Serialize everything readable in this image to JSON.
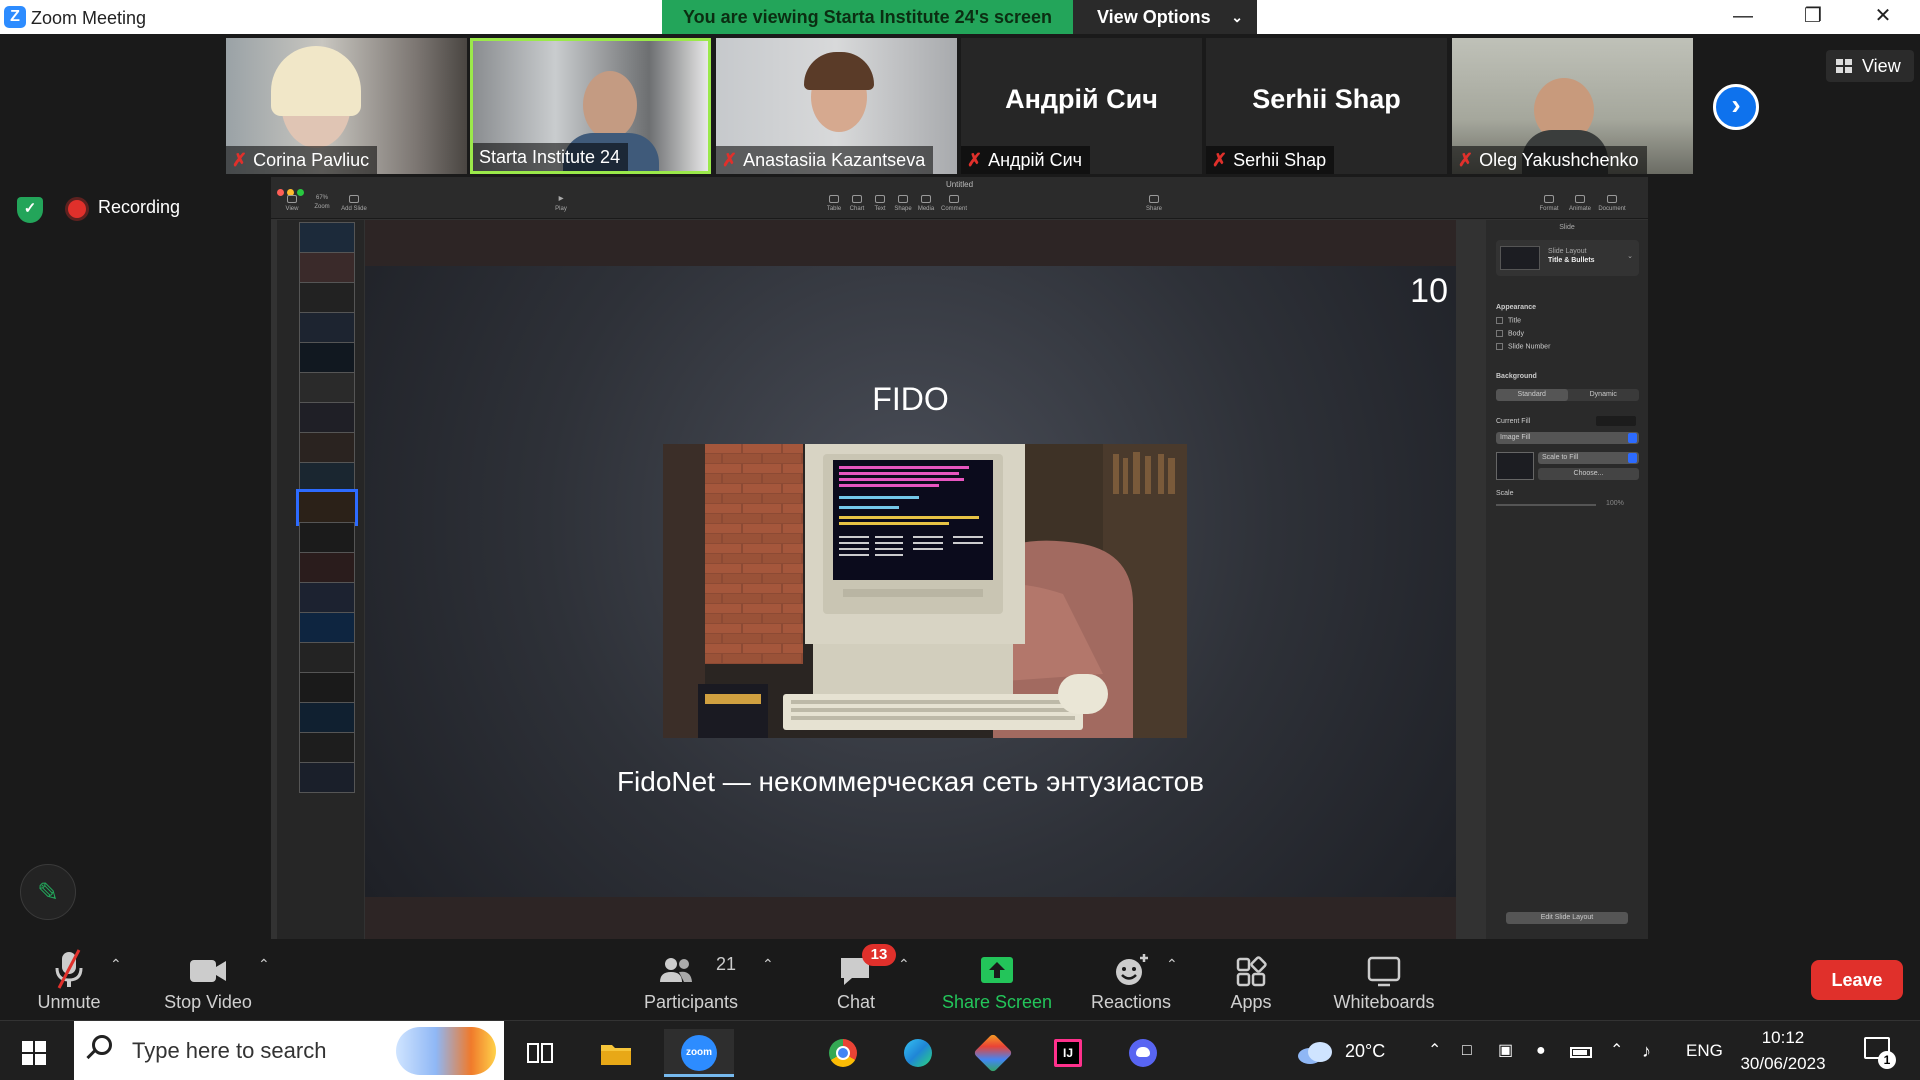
{
  "window": {
    "title": "Zoom Meeting",
    "viewing_banner": "You are viewing Starta Institute 24's screen",
    "view_options": "View Options"
  },
  "participants_strip": {
    "tiles": [
      {
        "name": "Corina Pavliuc",
        "muted": true,
        "video": true
      },
      {
        "name": "Starta Institute 24",
        "muted": false,
        "video": true,
        "active_speaker": true
      },
      {
        "name": "Anastasiia Kazantseva",
        "muted": true,
        "video": true
      },
      {
        "name": "Андрій Сич",
        "muted": true,
        "video": false
      },
      {
        "name": "Serhii Shap",
        "muted": true,
        "video": false
      },
      {
        "name": "Oleg Yakushchenko",
        "muted": true,
        "video": true
      }
    ],
    "view_label": "View"
  },
  "status": {
    "recording_label": "Recording"
  },
  "keynote": {
    "doc_title": "Untitled",
    "toolbar_left": [
      "View",
      "Zoom",
      "Add Slide"
    ],
    "zoom_value": "67%",
    "play_label": "Play",
    "toolbar_mid": [
      "Table",
      "Chart",
      "Text",
      "Shape",
      "Media",
      "Comment"
    ],
    "share_label": "Share",
    "toolbar_right": [
      "Format",
      "Animate",
      "Document"
    ],
    "slide_count": 19,
    "selected_slide": 10,
    "slide": {
      "number": "10",
      "title": "FIDO",
      "caption": "FidoNet — некоммерческая сеть энтузиастов"
    },
    "inspector": {
      "header": "Slide",
      "layout_label": "Slide Layout",
      "layout_value": "Title & Bullets",
      "appearance": "Appearance",
      "checkboxes": [
        "Title",
        "Body",
        "Slide Number"
      ],
      "background": "Background",
      "seg_standard": "Standard",
      "seg_dynamic": "Dynamic",
      "current_fill": "Current Fill",
      "fill_type": "Image Fill",
      "scale_mode": "Scale to Fill",
      "choose": "Choose...",
      "scale": "Scale",
      "scale_value": "100%",
      "edit_layout": "Edit Slide Layout"
    }
  },
  "toolbar": {
    "unmute": "Unmute",
    "stop_video": "Stop Video",
    "participants": "Participants",
    "participants_count": "21",
    "chat": "Chat",
    "chat_badge": "13",
    "share_screen": "Share Screen",
    "reactions": "Reactions",
    "apps": "Apps",
    "whiteboards": "Whiteboards",
    "leave": "Leave"
  },
  "taskbar": {
    "search_placeholder": "Type here to search",
    "weather": "20°C",
    "lang": "ENG",
    "time": "10:12",
    "date": "30/06/2023",
    "notifications": "1",
    "zoom_label": "zoom"
  },
  "colors": {
    "zoom_blue": "#2d8cff",
    "green": "#23a55a",
    "leave_red": "#e0302b",
    "active_border": "#9be94a"
  }
}
